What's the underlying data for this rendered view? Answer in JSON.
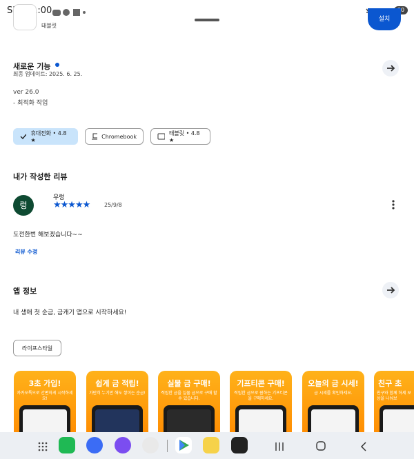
{
  "status_bar": {
    "time": "SKT 11:00",
    "battery": "30"
  },
  "header": {
    "device_tag": "태블릿",
    "install_label": "설치"
  },
  "whats_new": {
    "title": "새로운 기능",
    "updated": "최종 업데이트: 2025. 6. 25.",
    "version": "ver 26.0",
    "note": "- 최적화 작업"
  },
  "device_chips": [
    {
      "label": "휴대전화 • 4.8 ★",
      "selected": true
    },
    {
      "label": "Chromebook",
      "selected": false
    },
    {
      "label": "태블릿 • 4.8 ★",
      "selected": false
    }
  ],
  "my_review": {
    "title": "내가 작성한 리뷰",
    "avatar_letter": "렁",
    "user": "우렁",
    "rating": 5,
    "date": "25/9/8",
    "text": "도전한번 해보겠습니다~~",
    "edit_label": "리뷰 수정"
  },
  "app_info": {
    "title": "앱 정보",
    "description": "내 생애 첫 순금, 금캐기 앱으로 시작하세요!",
    "category": "라이프스타일"
  },
  "screenshots": [
    {
      "title": "3초 가입!",
      "sub": "카카오톡으로 간편하게 시작하세요!"
    },
    {
      "title": "쉽게 금 적립!",
      "sub": "가만히 누기만 해도 쌓이는 순금!"
    },
    {
      "title": "실물 금 구매!",
      "sub": "적립한 금을 실물 금으로 구매 할 수 있습니다."
    },
    {
      "title": "기프티콘 구매!",
      "sub": "적립한 금으로 원하는 기프티콘을 구매하세요."
    },
    {
      "title": "오늘의 금 시세!",
      "sub": "금 시세를 확인하세요."
    },
    {
      "title": "친구 초",
      "sub": "친구와 함께 하세 보상을 나눠보"
    }
  ],
  "colors": {
    "accent": "#0b57d0",
    "avatar_bg": "#0e4a32",
    "chip_selected": "#c9e4fb",
    "screenshot_orange": "#ff9a00"
  }
}
